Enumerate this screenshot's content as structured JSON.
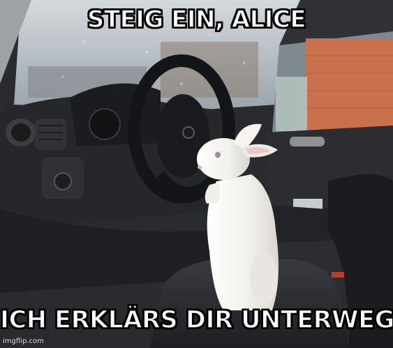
{
  "meme": {
    "top_text": "STEIG EIN, ALICE",
    "bottom_text": "ICH ERKLÄRS DIR UNTERWEGS",
    "watermark": "imgflip.com"
  },
  "scene": {
    "subject": "white rabbit",
    "colors": {
      "dashboard": "#26272b",
      "seat": "#2b2c30",
      "window_glass": "#b9c0c6",
      "brick_wall": "#c8714c",
      "rabbit_fur": "#f3f1ee"
    }
  }
}
